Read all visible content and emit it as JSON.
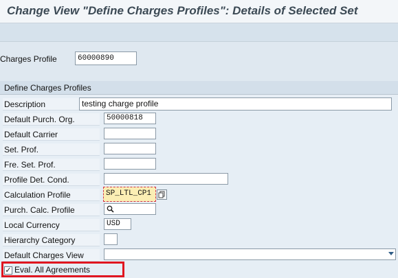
{
  "window": {
    "title": "Change View \"Define Charges Profiles\": Details of Selected Set"
  },
  "header": {
    "charges_profile_label": "Charges Profile",
    "charges_profile_value": "60000890"
  },
  "group": {
    "title": "Define Charges Profiles",
    "fields": {
      "description": {
        "label": "Description",
        "value": "testing charge profile"
      },
      "purch_org": {
        "label": "Default Purch. Org.",
        "value": "50000818"
      },
      "carrier": {
        "label": "Default Carrier",
        "value": ""
      },
      "set_prof": {
        "label": "Set. Prof.",
        "value": ""
      },
      "fre_set_prof": {
        "label": "Fre. Set. Prof.",
        "value": ""
      },
      "profile_det_cond": {
        "label": "Profile Det. Cond.",
        "value": ""
      },
      "calc_profile": {
        "label": "Calculation Profile",
        "value": "SP_LTL_CP1"
      },
      "purch_calc_profile": {
        "label": "Purch. Calc. Profile",
        "value": ""
      },
      "local_currency": {
        "label": "Local Currency",
        "value": "USD"
      },
      "hierarchy_category": {
        "label": "Hierarchy Category",
        "value": ""
      },
      "charges_view": {
        "label": "Default Charges View",
        "value": ""
      }
    },
    "eval_agreements": {
      "label": "Eval. All Agreements",
      "checked": true
    }
  },
  "icons": {
    "search": "search-icon",
    "copy": "copy-icon",
    "dropdown": "chevron-down-icon",
    "check": "checkmark-icon"
  },
  "colors": {
    "highlight_field": "#fbeeb4",
    "annotation_box": "#e0151f"
  }
}
